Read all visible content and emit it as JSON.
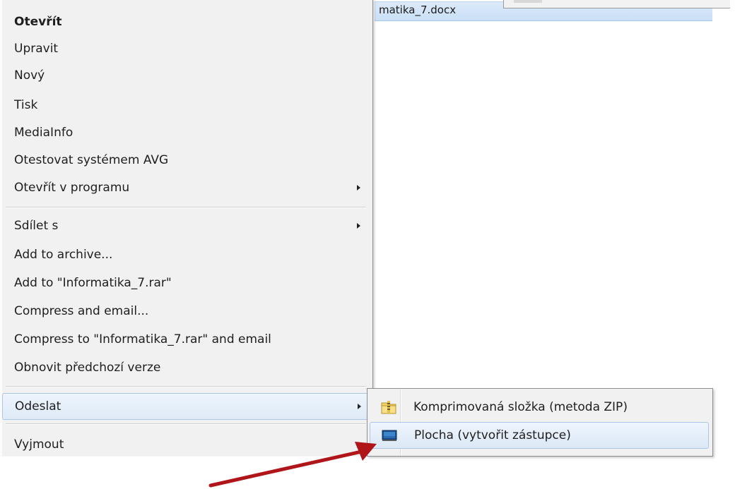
{
  "explorer": {
    "selected_file": "matika_7.docx"
  },
  "context_menu": {
    "items": [
      {
        "label": "Otevřít",
        "bold": true,
        "submenu": false
      },
      {
        "label": "Upravit",
        "bold": false,
        "submenu": false
      },
      {
        "label": "Nový",
        "bold": false,
        "submenu": false
      },
      {
        "label": "Tisk",
        "bold": false,
        "submenu": false
      },
      {
        "label": "MediaInfo",
        "bold": false,
        "submenu": false
      },
      {
        "label": "Otestovat systémem AVG",
        "bold": false,
        "submenu": false
      },
      {
        "label": "Otevřít v programu",
        "bold": false,
        "submenu": true
      },
      {
        "label": "Sdílet s",
        "bold": false,
        "submenu": true
      },
      {
        "label": "Add to archive...",
        "bold": false,
        "submenu": false
      },
      {
        "label": "Add to \"Informatika_7.rar\"",
        "bold": false,
        "submenu": false
      },
      {
        "label": "Compress and email...",
        "bold": false,
        "submenu": false
      },
      {
        "label": "Compress to \"Informatika_7.rar\" and email",
        "bold": false,
        "submenu": false
      },
      {
        "label": "Obnovit předchozí verze",
        "bold": false,
        "submenu": false
      },
      {
        "label": "Odeslat",
        "bold": false,
        "submenu": true,
        "active": true
      },
      {
        "label": "Vyjmout",
        "bold": false,
        "submenu": false
      }
    ]
  },
  "send_to_submenu": {
    "items": [
      {
        "label": "Komprimovaná složka (metoda ZIP)",
        "icon": "zip-folder-icon"
      },
      {
        "label": "Plocha (vytvořit zástupce)",
        "icon": "desktop-icon",
        "hovered": true
      }
    ]
  },
  "colors": {
    "menu_background": "#f1f1f1",
    "highlight": "#dce8f6",
    "annotation_arrow": "#b0151a"
  }
}
